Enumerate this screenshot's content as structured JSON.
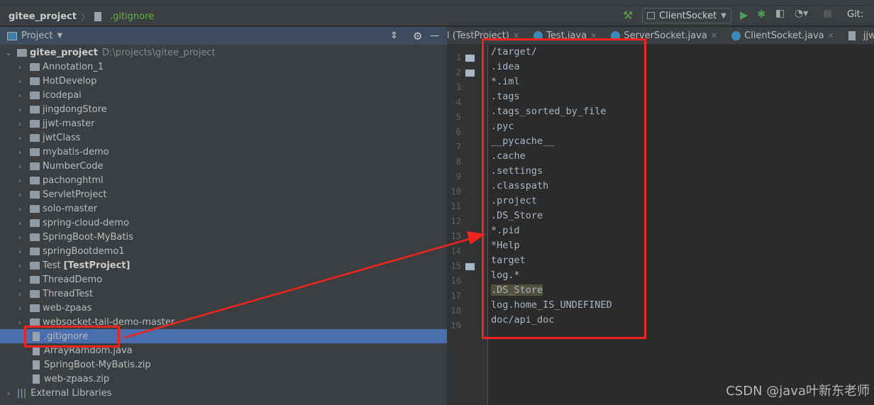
{
  "breadcrumb": {
    "project": "gitee_project",
    "file": ".gitignore"
  },
  "toolbar": {
    "run_config": "ClientSocket",
    "git_label": "Git:"
  },
  "project_panel": {
    "title": "Project"
  },
  "tree": {
    "root": {
      "name": "gitee_project",
      "path": "D:\\projects\\gitee_project"
    },
    "folders": [
      "Annotation_1",
      "HotDevelop",
      "icodepai",
      "jingdongStore",
      "jjwt-master",
      "jwtClass",
      "mybatis-demo",
      "NumberCode",
      "pachonghtml",
      "ServletProject",
      "solo-master",
      "spring-cloud-demo",
      "SpringBoot-MyBatis",
      "springBootdemo1",
      "Test",
      "ThreadDemo",
      "ThreadTest",
      "web-zpaas",
      "websocket-tail-demo-master"
    ],
    "test_module_suffix": "[TestProject]",
    "files": [
      ".gitignore",
      "ArrayRamdom.java",
      "SpringBoot-MyBatis.zip",
      "web-zpaas.zip"
    ],
    "external": "External Libraries"
  },
  "tabs": [
    "l (TestProject)",
    "Test.java",
    "ServerSocket.java",
    "ClientSocket.java",
    "jjwt-master\\"
  ],
  "editor": {
    "lines": [
      "/target/",
      ".idea",
      "*.iml",
      ".tags",
      ".tags_sorted_by_file",
      ".pyc",
      "__pycache__",
      ".cache",
      ".settings",
      ".classpath",
      ".project",
      ".DS_Store",
      "*.pid",
      "*Help",
      "target",
      "log.*",
      ".DS_Store",
      "log.home_IS_UNDEFINED",
      "doc/api_doc"
    ],
    "highlighted_line": 17,
    "fold_lines": [
      1,
      2,
      15
    ]
  },
  "watermark": "CSDN @java叶新东老师"
}
